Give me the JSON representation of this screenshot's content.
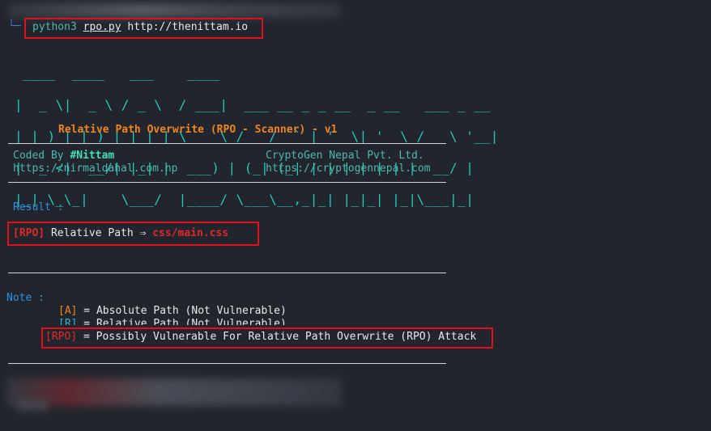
{
  "prompt": {
    "prefix": "└─",
    "command": "python3",
    "script": "rpo.py",
    "url": "http://thenittam.io"
  },
  "banner": {
    "ascii_lines": [
      " ____  ____   ___    ____                                       ",
      "|  _ \\|  _ \\ / _ \\  / ___|  ___ __ _ _ __  _ __   ___ _ __      ",
      "| |_) | |_) | | | | \\___ \\ / __/ _` | '_ \\| '_ \\ / _ \\ '__|     ",
      "|  _ <|  __/| |_| |  ___) | (_| (_| | | | | | | |  __/ |        ",
      "|_| \\_\\_|    \\___/  |____/ \\___\\__,_|_| |_|_| |_|\\___|_|        "
    ],
    "subtitle": "Relative Path Overwrite (RPO - Scanner) - v1"
  },
  "credits": {
    "coded_by_label": "Coded By",
    "author": "#Nittam",
    "author_url": "https://nirmaldahal.com.np",
    "company": "CryptoGen Nepal Pvt. Ltd.",
    "company_url": "https://cryptogennepal.com"
  },
  "result": {
    "label": "Result :",
    "tag": "[RPO]",
    "text": " Relative Path ⇒ ",
    "path": "css/main.css"
  },
  "note": {
    "label": "Note :",
    "items": [
      {
        "tag": "[A]",
        "text": " = Absolute Path (Not Vulnerable)"
      },
      {
        "tag": "[R]",
        "text": " = Relative Path (Not Vulnerable)"
      },
      {
        "tag": "[RPO]",
        "text": " = Possibly Vulnerable For Relative Path Overwrite (RPO) Attack"
      }
    ]
  },
  "colors": {
    "background": "#22252d",
    "highlight_box": "#e0101a",
    "ascii": "#23c9b6",
    "subtitle": "#f0861e",
    "label_blue": "#2f8fe0"
  }
}
